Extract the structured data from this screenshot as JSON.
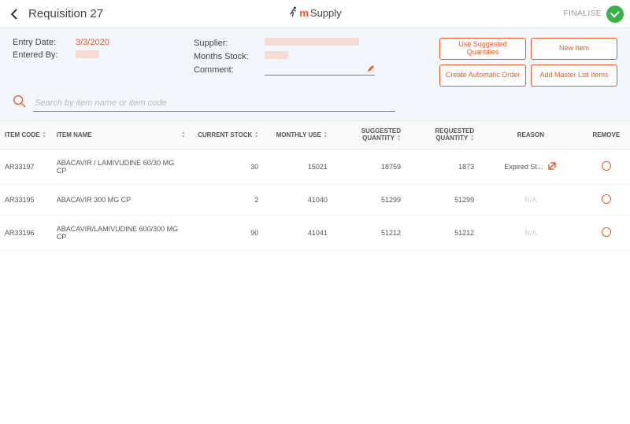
{
  "header": {
    "page_title": "Requisition 27",
    "app_pre": "m",
    "app_post": "Supply",
    "finalise_label": "FINALISE"
  },
  "info": {
    "entry_date_label": "Entry Date:",
    "entry_date_value": "3/3/2020",
    "entered_by_label": "Entered By:",
    "supplier_label": "Supplier:",
    "months_stock_label": "Months Stock:",
    "comment_label": "Comment:"
  },
  "buttons": {
    "suggested": "Use Suggested Quantities",
    "new_item": "New Item",
    "auto_order": "Create Automatic Order",
    "master_list": "Add Master List Items"
  },
  "search": {
    "placeholder": "Search by item name or item code"
  },
  "columns": {
    "code": "ITEM CODE",
    "name": "ITEM NAME",
    "current_stock": "CURRENT STOCK",
    "monthly_use": "MONTHLY USE",
    "suggested_qty": "SUGGESTED QUANTITY",
    "requested_qty": "REQUESTED QUANTITY",
    "reason": "REASON",
    "remove": "REMOVE"
  },
  "rows": [
    {
      "code": "AR33197",
      "name": "ABACAVIR / LAMIVUDINE 60/30 MG CP",
      "current_stock": "30",
      "monthly_use": "15021",
      "suggested_qty": "18759",
      "requested_qty": "1873",
      "reason": "Expired St...",
      "reason_na": false
    },
    {
      "code": "AR33195",
      "name": "ABACAVIR 300 MG CP",
      "current_stock": "2",
      "monthly_use": "41040",
      "suggested_qty": "51299",
      "requested_qty": "51299",
      "reason": "N/A",
      "reason_na": true
    },
    {
      "code": "AR33196",
      "name": "ABACAVIR/LAMIVUDINE 600/300 MG CP",
      "current_stock": "90",
      "monthly_use": "41041",
      "suggested_qty": "51212",
      "requested_qty": "51212",
      "reason": "N/A",
      "reason_na": true
    }
  ]
}
